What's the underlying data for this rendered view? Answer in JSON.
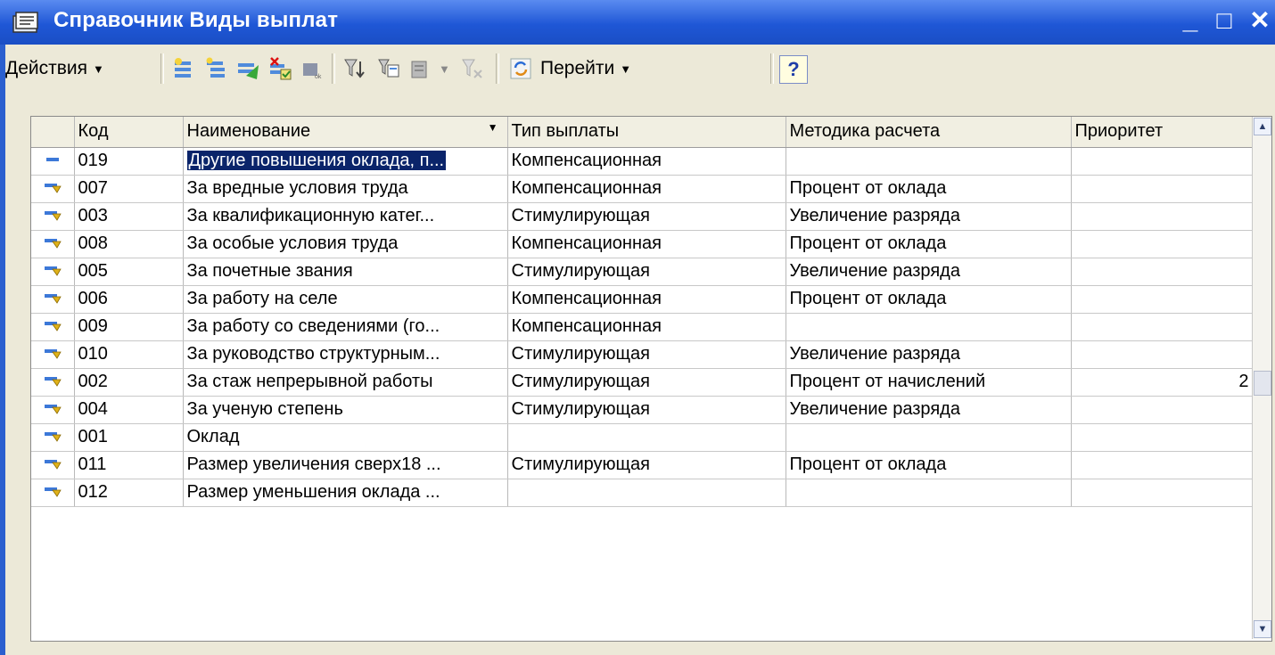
{
  "window": {
    "title": "Справочник Виды выплат",
    "minimize": "_",
    "maximize": "□",
    "close": "✕"
  },
  "toolbar": {
    "actions_label": "Действия",
    "goto_label": "Перейти",
    "help_label": "?",
    "icons": [
      "add-item-icon",
      "add-group-icon",
      "copy-item-icon",
      "delete-mark-icon",
      "ok-icon",
      "filter-icon",
      "filter-settings-icon",
      "filter-history-icon",
      "clear-filter-icon",
      "refresh-icon"
    ]
  },
  "table": {
    "columns": [
      "",
      "Код",
      "Наименование",
      "Тип выплаты",
      "Методика расчета",
      "Приоритет"
    ],
    "rows": [
      {
        "code": "019",
        "name": "Другие повышения оклада, п...",
        "type": "Компенсационная",
        "method": "",
        "priority": ""
      },
      {
        "code": "007",
        "name": "За вредные условия труда",
        "type": "Компенсационная",
        "method": "Процент от оклада",
        "priority": ""
      },
      {
        "code": "003",
        "name": "За квалификационную катег...",
        "type": "Стимулирующая",
        "method": "Увеличение разряда",
        "priority": ""
      },
      {
        "code": "008",
        "name": "За особые условия труда",
        "type": "Компенсационная",
        "method": "Процент от оклада",
        "priority": ""
      },
      {
        "code": "005",
        "name": "За почетные звания",
        "type": "Стимулирующая",
        "method": "Увеличение разряда",
        "priority": ""
      },
      {
        "code": "006",
        "name": "За работу на селе",
        "type": "Компенсационная",
        "method": "Процент от оклада",
        "priority": ""
      },
      {
        "code": "009",
        "name": "За работу со сведениями (го...",
        "type": "Компенсационная",
        "method": "",
        "priority": ""
      },
      {
        "code": "010",
        "name": "За руководство структурным...",
        "type": "Стимулирующая",
        "method": "Увеличение разряда",
        "priority": ""
      },
      {
        "code": "002",
        "name": "За стаж непрерывной работы",
        "type": "Стимулирующая",
        "method": "Процент от начислений",
        "priority": "2"
      },
      {
        "code": "004",
        "name": "За ученую степень",
        "type": "Стимулирующая",
        "method": "Увеличение разряда",
        "priority": ""
      },
      {
        "code": "001",
        "name": "Оклад",
        "type": "",
        "method": "",
        "priority": ""
      },
      {
        "code": "011",
        "name": "Размер увеличения сверх18 ...",
        "type": "Стимулирующая",
        "method": "Процент от оклада",
        "priority": ""
      },
      {
        "code": "012",
        "name": "Размер уменьшения оклада ...",
        "type": "",
        "method": "",
        "priority": ""
      }
    ]
  }
}
